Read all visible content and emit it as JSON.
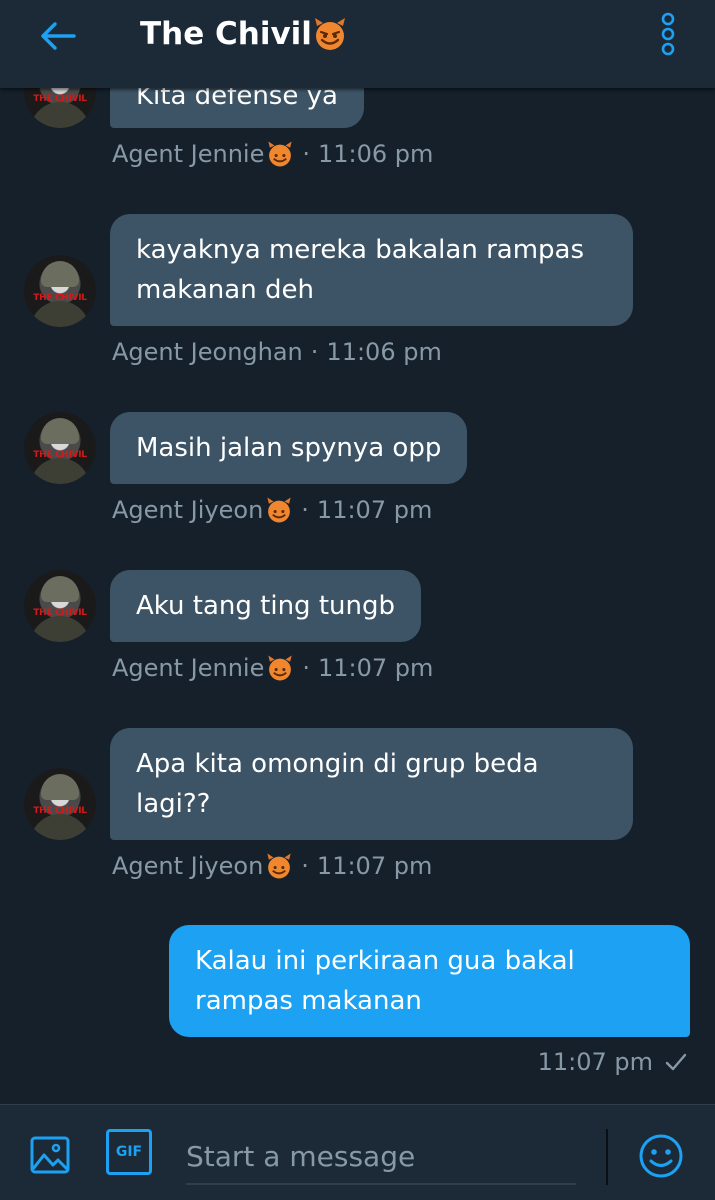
{
  "colors": {
    "background": "#15202b",
    "header": "#1c2a38",
    "incoming_bubble": "#3d5466",
    "outgoing_bubble": "#1da1f2",
    "accent": "#1da1f2",
    "meta_text": "#8899a6"
  },
  "header": {
    "title": "The Chivil ",
    "back_icon": "arrow-left-icon",
    "menu_icon": "overflow-menu-icon"
  },
  "messages": [
    {
      "direction": "in",
      "text": "Kita defense ya",
      "sender": "Agent Jennie ",
      "sender_emoji": "smiling-devil-emoji",
      "time": "11:06 pm"
    },
    {
      "direction": "in",
      "text": "kayaknya mereka bakalan rampas makanan deh",
      "sender": "Agent Jeonghan",
      "time": "11:06 pm"
    },
    {
      "direction": "in",
      "text": "Masih jalan spynya opp",
      "sender": "Agent Jiyeon ",
      "sender_emoji": "smiling-devil-emoji",
      "time": "11:07 pm"
    },
    {
      "direction": "in",
      "text": "Aku tang ting tungb",
      "sender": "Agent Jennie ",
      "sender_emoji": "smiling-devil-emoji",
      "time": "11:07 pm"
    },
    {
      "direction": "in",
      "text": "Apa kita omongin di grup beda lagi??",
      "sender": "Agent Jiyeon ",
      "sender_emoji": "smiling-devil-emoji",
      "time": "11:07 pm"
    },
    {
      "direction": "out",
      "text": "Kalau ini perkiraan gua bakal rampas makanan",
      "time": "11:07 pm",
      "status_icon": "checkmark-icon"
    }
  ],
  "avatar_text": "THE CHIVIL",
  "composer": {
    "placeholder": "Start a message",
    "image_icon": "image-icon",
    "gif_label": "GIF",
    "emoji_icon": "emoji-smile-icon"
  }
}
